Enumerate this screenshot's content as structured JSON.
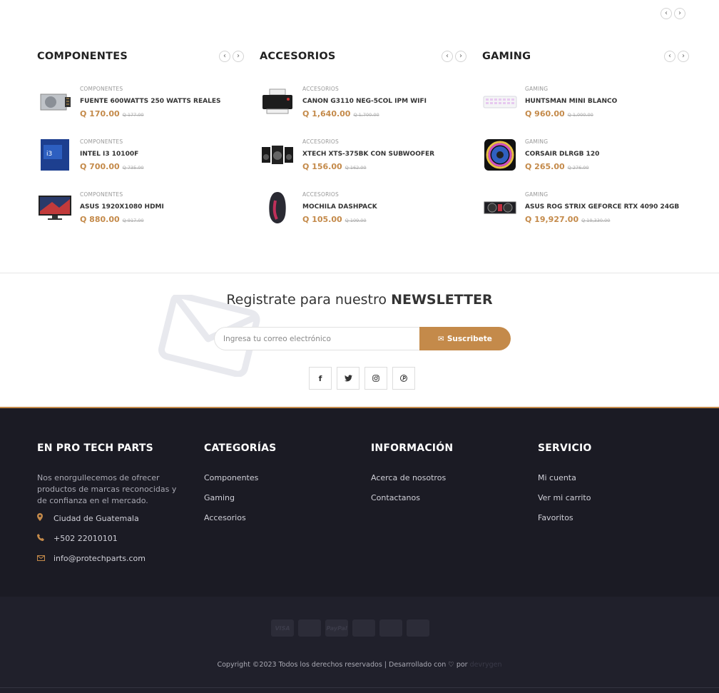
{
  "colors": {
    "accent": "#c48a4a",
    "footer_bg": "#1b1b24",
    "bottom_bg": "#20202b"
  },
  "nav_icons": {
    "prev": "‹",
    "next": "›"
  },
  "columns": [
    {
      "title": "COMPONENTES",
      "products": [
        {
          "category": "COMPONENTES",
          "name": "FUENTE 600WATTS 250 WATTS REALES",
          "price": "Q 170.00",
          "old_price": "Q 177.00",
          "image": "power-supply-image"
        },
        {
          "category": "COMPONENTES",
          "name": "INTEL I3 10100F",
          "price": "Q 700.00",
          "old_price": "Q 735.00",
          "image": "intel-cpu-box-image"
        },
        {
          "category": "COMPONENTES",
          "name": "ASUS 1920X1080 HDMI",
          "price": "Q 880.00",
          "old_price": "Q 917.00",
          "image": "monitor-image"
        }
      ]
    },
    {
      "title": "ACCESORIOS",
      "products": [
        {
          "category": "ACCESORIOS",
          "name": "CANON G3110 NEG-5COL IPM WIFI",
          "price": "Q 1,640.00",
          "old_price": "Q 1,700.00",
          "image": "printer-image"
        },
        {
          "category": "ACCESORIOS",
          "name": "XTECH XTS-375BK CON SUBWOOFER",
          "price": "Q 156.00",
          "old_price": "Q 162.00",
          "image": "speakers-image"
        },
        {
          "category": "ACCESORIOS",
          "name": "MOCHILA DASHPACK",
          "price": "Q 105.00",
          "old_price": "Q 109.00",
          "image": "backpack-image"
        }
      ]
    },
    {
      "title": "GAMING",
      "products": [
        {
          "category": "GAMING",
          "name": "HUNTSMAN MINI BLANCO",
          "price": "Q 960.00",
          "old_price": "Q 1,000.00",
          "image": "keyboard-image"
        },
        {
          "category": "GAMING",
          "name": "CORSAIR DLRGB 120",
          "price": "Q 265.00",
          "old_price": "Q 276.00",
          "image": "rgb-fan-image"
        },
        {
          "category": "GAMING",
          "name": "ASUS ROG STRIX GEFORCE RTX 4090 24GB",
          "price": "Q 19,927.00",
          "old_price": "Q 19,330.00",
          "image": "graphics-card-image"
        }
      ]
    }
  ],
  "newsletter": {
    "title_prefix": "Registrate para nuestro",
    "title_bold": "NEWSLETTER",
    "placeholder": "Ingresa tu correo electrónico",
    "button_label": "Suscribete",
    "socials": [
      {
        "icon": "facebook-icon",
        "glyph": "f"
      },
      {
        "icon": "twitter-icon",
        "glyph": "🐦"
      },
      {
        "icon": "instagram-icon",
        "glyph": "◎"
      },
      {
        "icon": "pinterest-icon",
        "glyph": "℗"
      }
    ]
  },
  "footer": {
    "about": {
      "title": "EN PRO TECH PARTS",
      "description": "Nos enorgullecemos de ofrecer productos de marcas reconocidas y de confianza en el mercado.",
      "address": "Ciudad de Guatemala",
      "phone": "+502 22010101",
      "email": "info@protechparts.com"
    },
    "categories": {
      "title": "CATEGORÍAS",
      "links": [
        "Componentes",
        "Gaming",
        "Accesorios"
      ]
    },
    "information": {
      "title": "INFORMACIÓN",
      "links": [
        "Acerca de nosotros",
        "Contactanos"
      ]
    },
    "service": {
      "title": "SERVICIO",
      "links": [
        "Mi cuenta",
        "Ver mi carrito",
        "Favoritos"
      ]
    }
  },
  "bottom": {
    "payment_cards": [
      "VISA",
      "",
      "PayPal",
      "",
      "",
      ""
    ],
    "copyright_prefix": "Copyright ©2023 Todos los derechos reservados | Desarrollado con",
    "copyright_por": "por",
    "developer": "devrygen"
  }
}
